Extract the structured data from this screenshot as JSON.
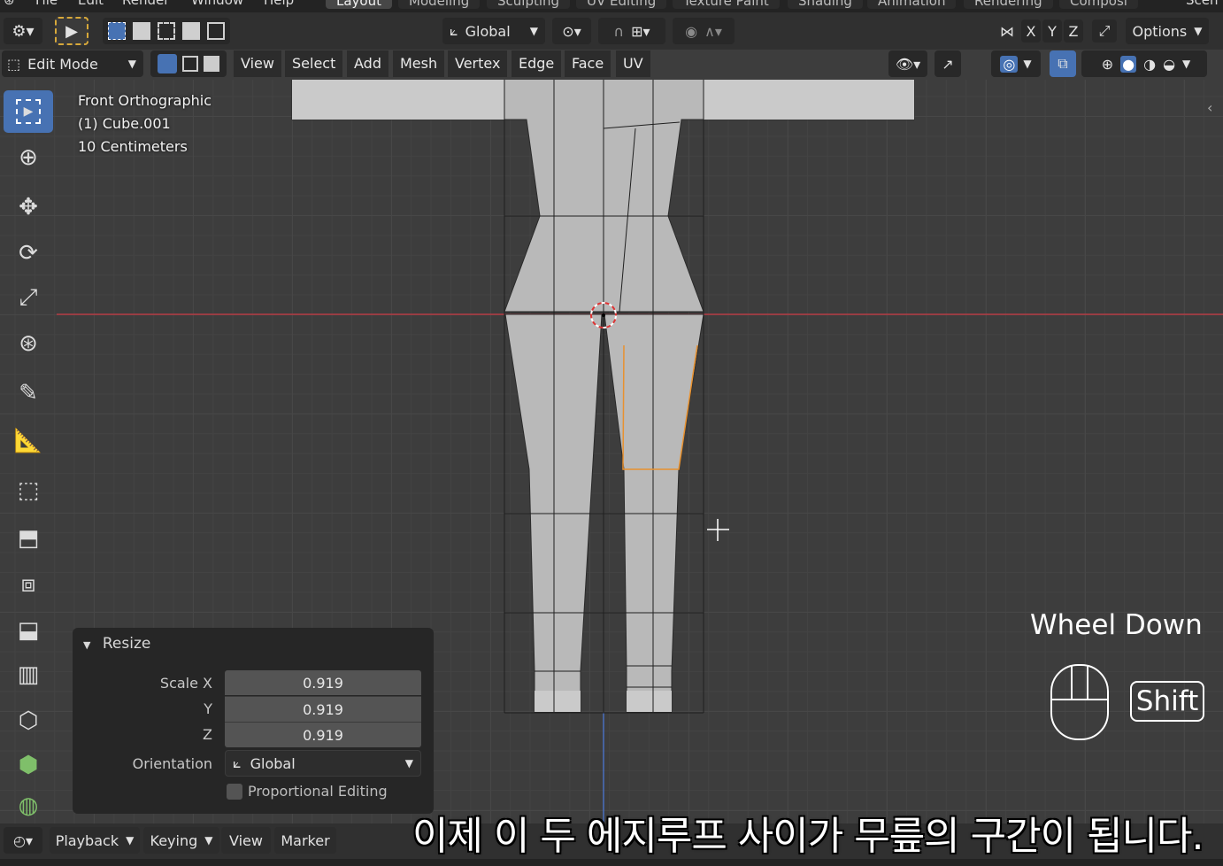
{
  "top_menu": {
    "items": [
      "File",
      "Edit",
      "Render",
      "Window",
      "Help"
    ],
    "workspaces": [
      "Layout",
      "Modeling",
      "Sculpting",
      "UV Editing",
      "Texture Paint",
      "Shading",
      "Animation",
      "Rendering",
      "Composi"
    ],
    "active_workspace": "Layout",
    "scene_label": "Scen"
  },
  "tool_header": {
    "orientation": "Global",
    "axes": [
      "X",
      "Y",
      "Z"
    ],
    "options_label": "Options"
  },
  "edit_header": {
    "mode": "Edit Mode",
    "menus": [
      "View",
      "Select",
      "Add",
      "Mesh",
      "Vertex",
      "Edge",
      "Face",
      "UV"
    ]
  },
  "viewport": {
    "view_name": "Front Orthographic",
    "object_info": "(1) Cube.001",
    "scale_info": "10 Centimeters"
  },
  "resize_panel": {
    "title": "Resize",
    "scale_x_label": "Scale X",
    "scale_y_label": "Y",
    "scale_z_label": "Z",
    "scale_x": "0.919",
    "scale_y": "0.919",
    "scale_z": "0.919",
    "orientation_label": "Orientation",
    "orientation_value": "Global",
    "proportional_label": "Proportional Editing"
  },
  "bottom_bar": {
    "items": [
      "Playback",
      "Keying",
      "View",
      "Marker"
    ]
  },
  "keystroke_overlay": {
    "action": "Wheel Down",
    "key": "Shift"
  },
  "subtitle": "이제 이 두 에지루프 사이가 무릎의 구간이 됩니다.",
  "colors": {
    "accent": "#4772b3",
    "selection": "#e8912f",
    "x_axis": "#b53b44",
    "z_axis": "#4a6fbf",
    "mesh_fill": "#b9b9b9"
  }
}
